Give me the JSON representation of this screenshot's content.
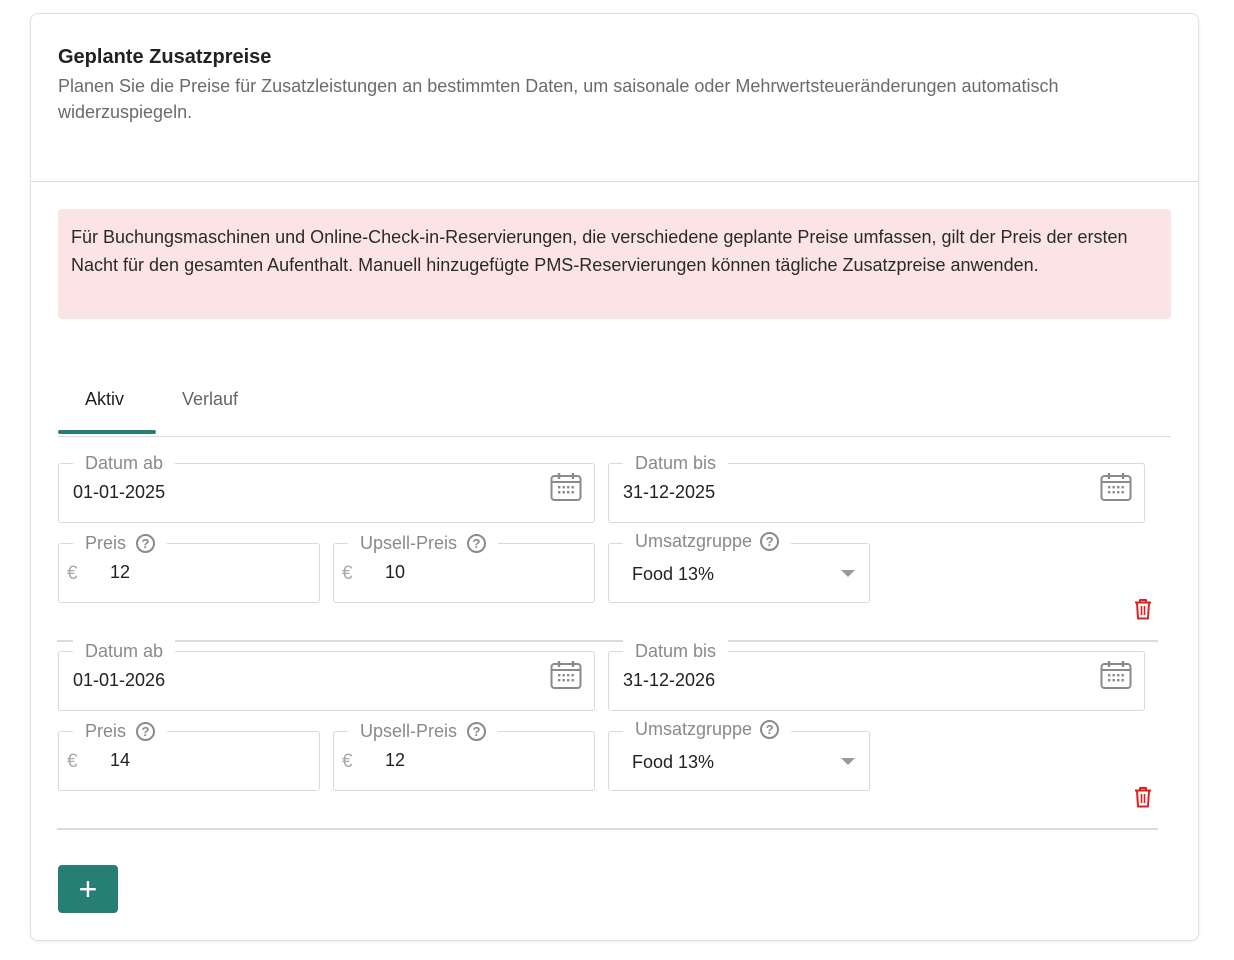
{
  "header": {
    "title": "Geplante Zusatzpreise",
    "description": "Planen Sie die Preise für Zusatzleistungen an bestimmten Daten, um saisonale oder Mehrwertsteueränderungen automatisch widerzuspiegeln."
  },
  "alert": {
    "text": "Für Buchungsmaschinen und Online-Check-in-Reservierungen, die verschiedene geplante Preise umfassen, gilt der Preis der ersten Nacht für den gesamten Aufenthalt. Manuell hinzugefügte PMS-Reservierungen können tägliche Zusatzpreise anwenden."
  },
  "tabs": [
    {
      "label": "Aktiv",
      "active": true
    },
    {
      "label": "Verlauf",
      "active": false
    }
  ],
  "labels": {
    "date_from": "Datum ab",
    "date_to": "Datum bis",
    "price": "Preis",
    "upsell_price": "Upsell-Preis",
    "revenue_group": "Umsatzgruppe",
    "currency": "€",
    "help": "?"
  },
  "rows": [
    {
      "date_from": "01-01-2025",
      "date_to": "31-12-2025",
      "price": "12",
      "upsell_price": "10",
      "revenue_group": "Food 13%"
    },
    {
      "date_from": "01-01-2026",
      "date_to": "31-12-2026",
      "price": "14",
      "upsell_price": "12",
      "revenue_group": "Food 13%"
    }
  ],
  "add_button": {
    "label": "+"
  },
  "colors": {
    "accent": "#267f72",
    "alert_bg": "#fde4e4",
    "danger": "#e01e1e"
  }
}
